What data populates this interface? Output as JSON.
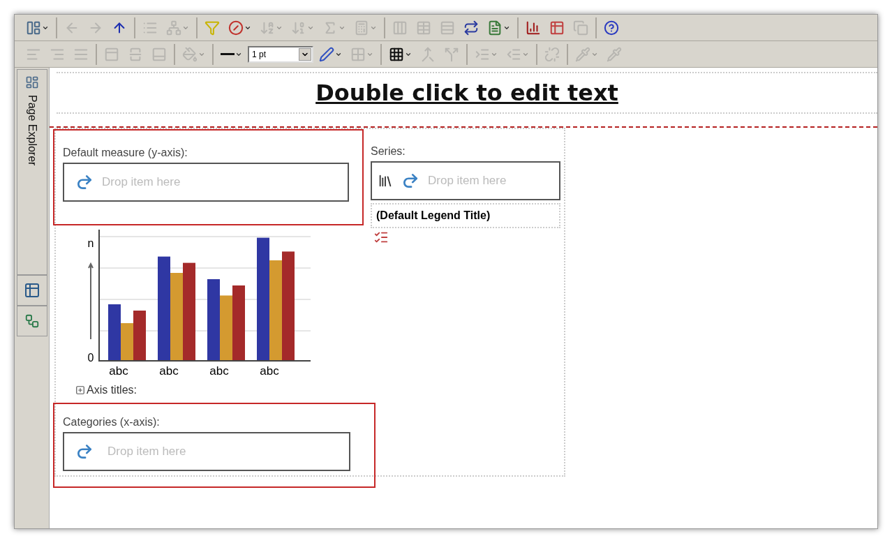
{
  "toolbars": [
    {
      "groups": [
        [
          {
            "kind": "insert",
            "disabled": false,
            "menu": true
          }
        ],
        [
          {
            "kind": "back",
            "disabled": true,
            "menu": false
          },
          {
            "kind": "forward",
            "disabled": true,
            "menu": false
          },
          {
            "kind": "up",
            "disabled": false,
            "menu": false
          }
        ],
        [
          {
            "kind": "list",
            "disabled": true,
            "menu": false
          },
          {
            "kind": "tree",
            "disabled": true,
            "menu": true
          }
        ],
        [
          {
            "kind": "filter",
            "disabled": false,
            "menu": false
          },
          {
            "kind": "suppress",
            "disabled": false,
            "menu": true
          },
          {
            "kind": "sort-alpha",
            "disabled": true,
            "menu": true
          },
          {
            "kind": "sort-num",
            "disabled": true,
            "menu": true
          },
          {
            "kind": "sum",
            "disabled": true,
            "menu": true
          },
          {
            "kind": "calculate",
            "disabled": true,
            "menu": true
          }
        ],
        [
          {
            "kind": "columns",
            "disabled": true,
            "menu": false
          },
          {
            "kind": "table",
            "disabled": true,
            "menu": false
          },
          {
            "kind": "rows",
            "disabled": true,
            "menu": false
          },
          {
            "kind": "swap",
            "disabled": false,
            "menu": false
          },
          {
            "kind": "report",
            "disabled": false,
            "menu": true
          }
        ],
        [
          {
            "kind": "chart",
            "disabled": false,
            "menu": false
          },
          {
            "kind": "pivot",
            "disabled": false,
            "menu": false
          },
          {
            "kind": "copy",
            "disabled": true,
            "menu": false
          }
        ],
        [
          {
            "kind": "help",
            "disabled": false,
            "menu": false
          }
        ]
      ]
    },
    {
      "groups": [
        [
          {
            "kind": "align-left",
            "disabled": true,
            "menu": false
          },
          {
            "kind": "align-right",
            "disabled": true,
            "menu": false
          },
          {
            "kind": "align-justify",
            "disabled": true,
            "menu": false
          }
        ],
        [
          {
            "kind": "border-top",
            "disabled": true,
            "menu": false
          },
          {
            "kind": "border-middle",
            "disabled": true,
            "menu": false
          },
          {
            "kind": "border-bottom",
            "disabled": true,
            "menu": false
          }
        ],
        [
          {
            "kind": "fill",
            "disabled": true,
            "menu": true
          }
        ],
        [
          {
            "kind": "line",
            "disabled": false,
            "menu": true
          },
          {
            "kind": "select",
            "value": "1 pt"
          },
          {
            "kind": "pen",
            "disabled": false,
            "menu": true
          },
          {
            "kind": "borders",
            "disabled": true,
            "menu": true
          }
        ],
        [
          {
            "kind": "grid",
            "disabled": false,
            "menu": true
          },
          {
            "kind": "merge",
            "disabled": true,
            "menu": false
          },
          {
            "kind": "split",
            "disabled": true,
            "menu": false
          }
        ],
        [
          {
            "kind": "indent",
            "disabled": true,
            "menu": true
          },
          {
            "kind": "outdent",
            "disabled": true,
            "menu": true
          }
        ],
        [
          {
            "kind": "unlink",
            "disabled": true,
            "menu": false
          }
        ],
        [
          {
            "kind": "pipette",
            "disabled": true,
            "menu": true
          },
          {
            "kind": "pipette",
            "disabled": true,
            "menu": false
          }
        ]
      ]
    }
  ],
  "side_tab": {
    "label": "Page Explorer"
  },
  "canvas": {
    "heading": "Double click to edit text",
    "y_axis": {
      "label": "Default measure (y-axis):",
      "hint": "Drop item here"
    },
    "series": {
      "label": "Series:",
      "hint": "Drop item here"
    },
    "legend_title": "(Default Legend Title)",
    "chart": {
      "y_labels": [
        "n",
        "0"
      ],
      "categories": [
        "abc",
        "abc",
        "abc",
        "abc"
      ]
    },
    "axis_titles": {
      "label": "Axis titles:",
      "expanded": false
    },
    "x_axis": {
      "label": "Categories (x-axis):",
      "hint": "Drop item here"
    }
  }
}
